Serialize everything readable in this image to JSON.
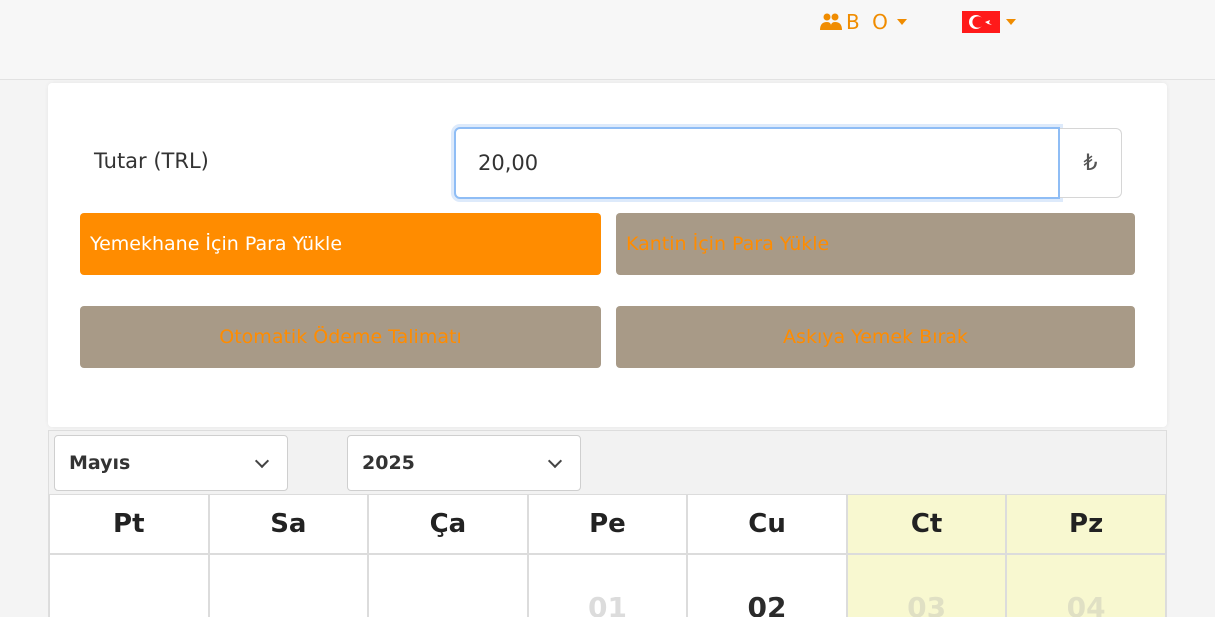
{
  "header": {
    "user_label": "B O",
    "accent_color": "#f08c00",
    "user_icon": "users-icon",
    "language_icon": "turkey-flag-icon"
  },
  "topup": {
    "amount_label": "Tutar (TRL)",
    "amount_value": "20,00",
    "currency_symbol": "₺"
  },
  "actions": {
    "cafeteria_label": "Yemekhane İçin Para Yükle",
    "canteen_label": "Kantin İçin Para Yükle",
    "autopay_label": "Otomatik Ödeme Talimatı",
    "suspended_meal_label": "Askıya Yemek Bırak"
  },
  "calendar": {
    "month": "Mayıs",
    "year": "2025",
    "weekdays": [
      "Pt",
      "Sa",
      "Ça",
      "Pe",
      "Cu",
      "Ct",
      "Pz"
    ],
    "days": [
      "",
      "",
      "",
      "01",
      "02",
      "03",
      "04"
    ]
  }
}
